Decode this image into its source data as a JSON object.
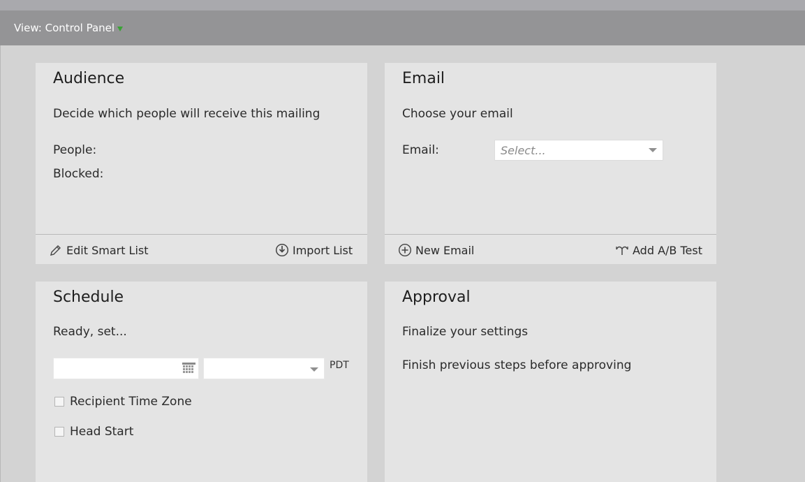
{
  "view_bar": {
    "label": "View: Control Panel",
    "indicator_color": "#3aa335"
  },
  "audience": {
    "title": "Audience",
    "subtitle": "Decide which people will receive this mailing",
    "people_label": "People:",
    "blocked_label": "Blocked:",
    "actions": {
      "edit_smart_list": "Edit Smart List",
      "import_list": "Import List"
    }
  },
  "email": {
    "title": "Email",
    "subtitle": "Choose your email",
    "email_label": "Email:",
    "select_placeholder": "Select...",
    "actions": {
      "new_email": "New Email",
      "add_ab_test": "Add A/B Test"
    }
  },
  "schedule": {
    "title": "Schedule",
    "subtitle": "Ready, set...",
    "date_value": "",
    "time_value": "",
    "timezone": "PDT",
    "options": [
      {
        "label": "Recipient Time Zone",
        "checked": false
      },
      {
        "label": "Head Start",
        "checked": false
      }
    ]
  },
  "approval": {
    "title": "Approval",
    "subtitle": "Finalize your settings",
    "status_text": "Finish previous steps before approving"
  }
}
